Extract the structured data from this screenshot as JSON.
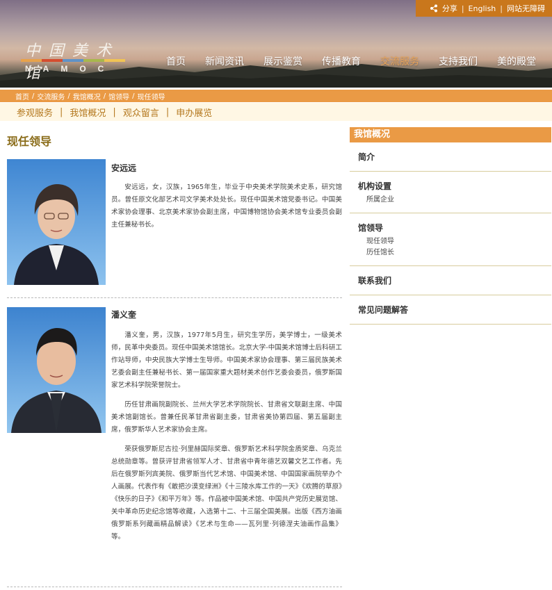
{
  "topbar": {
    "share": "分享",
    "english": "English",
    "accessibility": "网站无障碍",
    "separator": "|"
  },
  "logo": {
    "cn": "中国美术馆",
    "en": "NAMOC",
    "bar_colors": [
      "#e8a24a",
      "#d54d2f",
      "#5f92c8",
      "#a8b74c",
      "#f0c454"
    ]
  },
  "nav": {
    "items": [
      {
        "label": "首页",
        "active": false
      },
      {
        "label": "新闻资讯",
        "active": false
      },
      {
        "label": "展示鉴赏",
        "active": false
      },
      {
        "label": "传播教育",
        "active": false
      },
      {
        "label": "交流服务",
        "active": true
      },
      {
        "label": "支持我们",
        "active": false
      },
      {
        "label": "美的殿堂",
        "active": false
      }
    ]
  },
  "breadcrumb": {
    "items": [
      "首页",
      "交流服务",
      "我馆概况",
      "馆领导",
      "现任领导"
    ],
    "separator": "/"
  },
  "subnav": {
    "items": [
      "参观服务",
      "我馆概况",
      "观众留言",
      "申办展览"
    ],
    "separator": "|"
  },
  "page": {
    "title": "现任领导"
  },
  "leaders": [
    {
      "name": "安远远",
      "bio": [
        "安远远，女，汉族，1965年生，毕业于中央美术学院美术史系，研究馆员。曾任原文化部艺术司文学美术处处长。现任中国美术馆党委书记。中国美术家协会理事、北京美术家协会副主席，中国博物馆协会美术馆专业委员会副主任兼秘书长。"
      ]
    },
    {
      "name": "潘义奎",
      "bio": [
        "潘义奎，男，汉族，1977年5月生，研究生学历，美学博士，一级美术师，民革中央委员。现任中国美术馆馆长。北京大学-中国美术馆博士后科研工作站导师，中央民族大学博士生导师。中国美术家协会理事、第三届民族美术艺委会副主任兼秘书长、第一届国家重大题材美术创作艺委会委员，俄罗斯国家艺术科学院荣誉院士。",
        "历任甘肃画院副院长、兰州大学艺术学院院长、甘肃省文联副主席、中国美术馆副馆长。曾兼任民革甘肃省副主委，甘肃省美协第四届、第五届副主席，俄罗斯华人艺术家协会主席。",
        "荣获俄罗斯尼古拉·列里赫国际奖章、俄罗斯艺术科学院金质奖章、乌克兰总统勋章等。曾获评甘肃省领军人才、甘肃省中青年德艺双馨文艺工作者。先后在俄罗斯列宾美院、俄罗斯当代艺术馆、中国美术馆、中国国家画院举办个人画展。代表作有《敢把沙漠变绿洲》《十三陵水库工作的一天》《欢腾的草原》《快乐的日子》《和平万年》等。作品被中国美术馆、中国共产党历史展览馆、关中革命历史纪念馆等收藏，入选第十二、十三届全国美展。出版《西方油画俄罗斯系列藏画精品解读》《艺术与生命——瓦列里·列德涅夫油画作品集》等。"
      ]
    }
  ],
  "sidebar": {
    "header": "我馆概况",
    "sections": [
      {
        "title": "简介",
        "subs": []
      },
      {
        "title": "机构设置",
        "subs": [
          "所属企业"
        ]
      },
      {
        "title": "馆领导",
        "subs": [
          "现任领导",
          "历任馆长"
        ]
      },
      {
        "title": "联系我们",
        "subs": []
      },
      {
        "title": "常见问题解答",
        "subs": []
      }
    ]
  },
  "colors": {
    "accent_orange": "#ea9a45",
    "topbar_orange": "#c9771c",
    "title_olive": "#8a6c19",
    "subnav_bg": "#fff7e4"
  }
}
